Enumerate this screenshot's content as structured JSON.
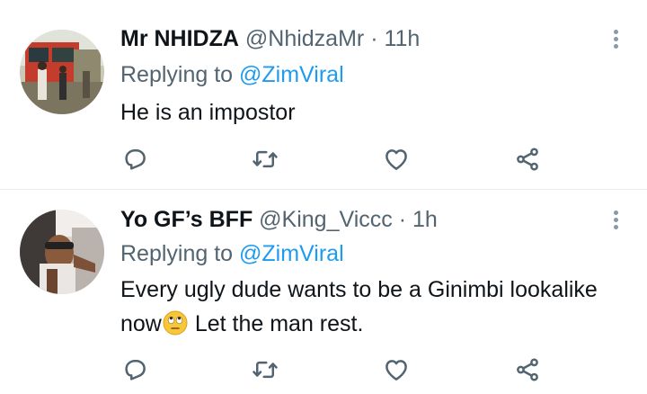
{
  "tweets": [
    {
      "name": "Mr NHIDZA",
      "handle": "@NhidzaMr",
      "separator": "·",
      "time": "11h",
      "replying_prefix": "Replying to",
      "replying_to": "@ZimViral",
      "text": "He is an impostor",
      "avatar_icon": "bus-photo-avatar"
    },
    {
      "name": "Yo GF’s BFF",
      "handle": "@King_Viccc",
      "separator": "·",
      "time": "1h",
      "replying_prefix": "Replying to",
      "replying_to": "@ZimViral",
      "text_before_emoji": "Every ugly dude wants to be a Ginimbi lookalike now",
      "emoji": "face-with-rolling-eyes-emoji",
      "text_after_emoji": " Let the man rest.",
      "avatar_icon": "car-selfie-avatar"
    }
  ],
  "colors": {
    "text": "#0f1419",
    "secondary": "#536471",
    "link": "#1d9bf0",
    "divider": "#e6ecf0"
  },
  "icons": [
    "reply-icon",
    "retweet-icon",
    "like-icon",
    "share-icon",
    "more-options-icon"
  ]
}
